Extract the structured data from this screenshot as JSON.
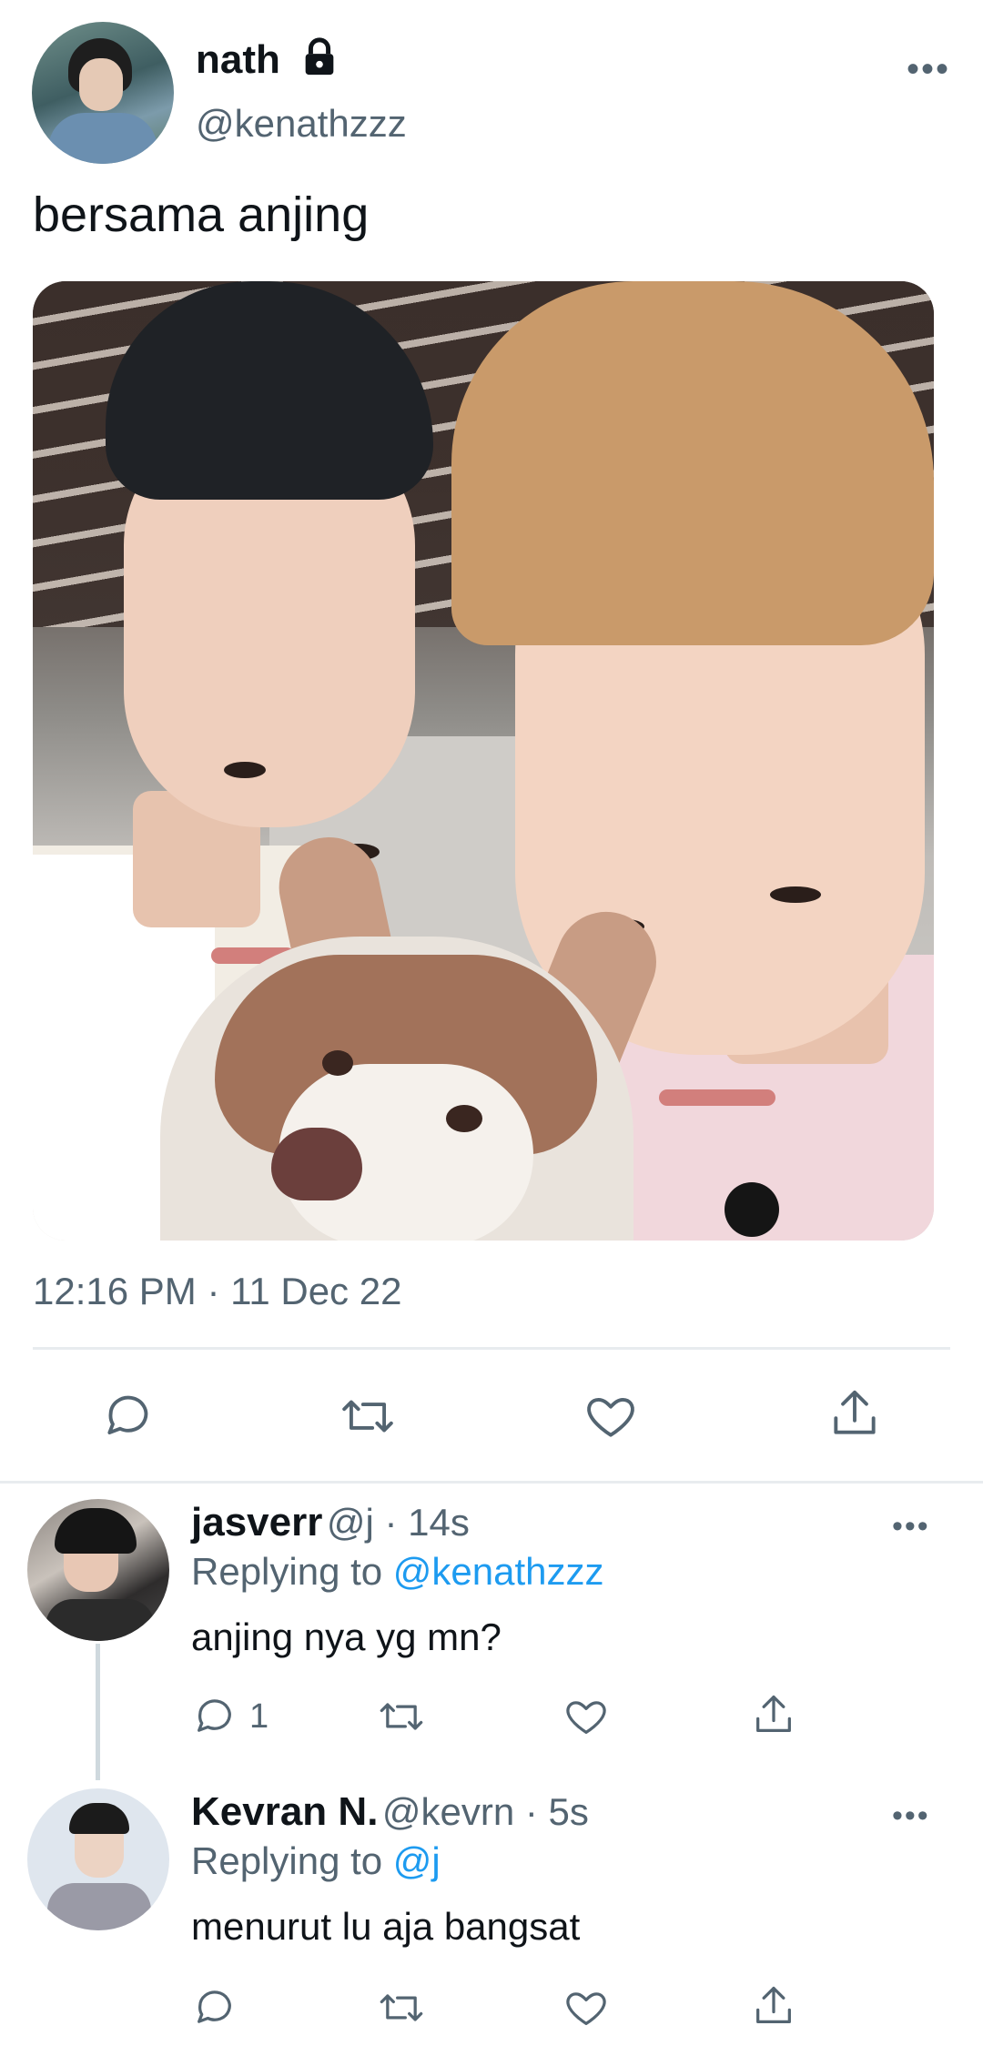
{
  "main_tweet": {
    "author_name": "nath",
    "handle": "@kenathzzz",
    "text": "bersama anjing",
    "timestamp": "12:16 PM · 11 Dec 22",
    "more": "•••"
  },
  "actions": {
    "reply_icon": "reply-icon",
    "retweet_icon": "retweet-icon",
    "like_icon": "heart-icon",
    "share_icon": "share-icon"
  },
  "replies": [
    {
      "name": "jasverr",
      "meta": "@j · 14s",
      "replying_label": "Replying to",
      "replying_to": "@kenathzzz",
      "text": "anjing nya yg mn?",
      "reply_count": "1",
      "more": "•••"
    },
    {
      "name": "Kevran N.",
      "meta": "@kevrn · 5s",
      "replying_label": "Replying to",
      "replying_to": "@j",
      "text": "menurut lu aja bangsat",
      "more": "•••"
    }
  ],
  "colors": {
    "text_primary": "#0f1419",
    "text_secondary": "#536471",
    "link": "#1d9bf0",
    "divider": "#e8ecef"
  }
}
